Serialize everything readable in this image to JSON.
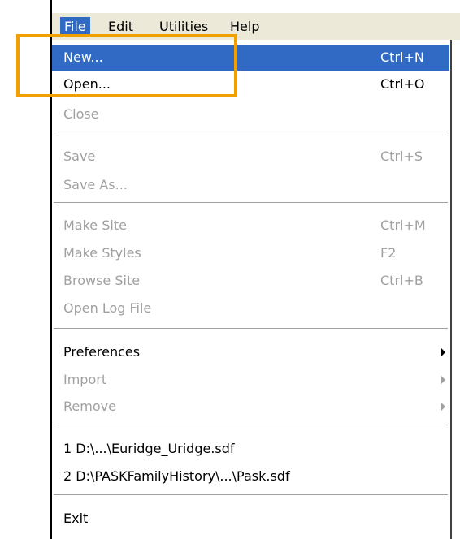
{
  "menubar": {
    "file": "File",
    "edit": "Edit",
    "utilities": "Utilities",
    "help": "Help"
  },
  "file_menu": {
    "new": {
      "label": "New...",
      "shortcut": "Ctrl+N"
    },
    "open": {
      "label": "Open...",
      "shortcut": "Ctrl+O"
    },
    "close": {
      "label": "Close"
    },
    "save": {
      "label": "Save",
      "shortcut": "Ctrl+S"
    },
    "save_as": {
      "label": "Save As..."
    },
    "make_site": {
      "label": "Make Site",
      "shortcut": "Ctrl+M"
    },
    "make_styles": {
      "label": "Make Styles",
      "shortcut": "F2"
    },
    "browse_site": {
      "label": "Browse Site",
      "shortcut": "Ctrl+B"
    },
    "open_log_file": {
      "label": "Open Log File"
    },
    "preferences": {
      "label": "Preferences"
    },
    "import": {
      "label": "Import"
    },
    "remove": {
      "label": "Remove"
    },
    "recent_1": {
      "label": "1 D:\\...\\Euridge_Uridge.sdf"
    },
    "recent_2": {
      "label": "2 D:\\PASKFamilyHistory\\...\\Pask.sdf"
    },
    "exit": {
      "label": "Exit"
    }
  },
  "colors": {
    "menu_highlight": "#316ac5",
    "annotation_box": "#f0a000",
    "disabled_text": "#a0a0a0"
  }
}
